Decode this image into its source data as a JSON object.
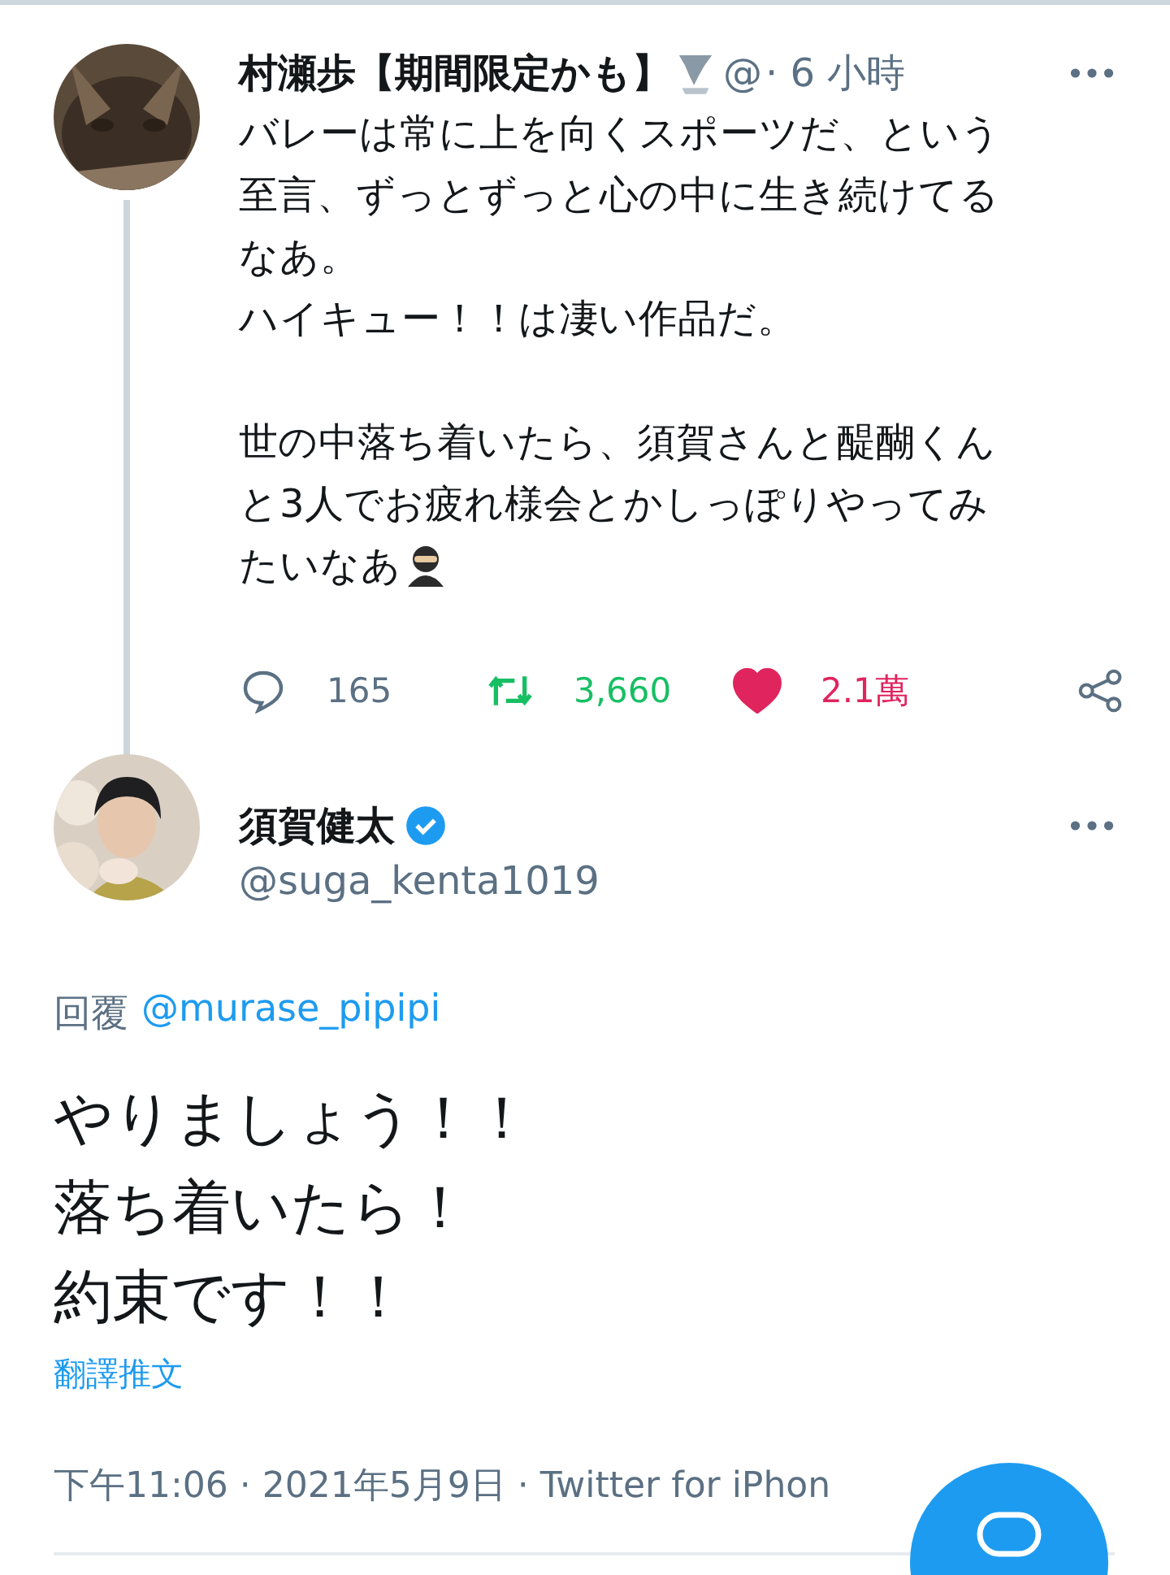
{
  "thread": [
    {
      "name": "村瀬歩【期間限定かも】",
      "handle": "@",
      "time": "· 6 小時",
      "paragraphs": [
        {
          "lines": [
            "バレーは常に上を向くスポーツだ、という",
            "至言、ずっとずっと心の中に生き続けてる",
            "なあ。",
            "ハイキュー！！は凄い作品だ。"
          ]
        },
        {
          "lines": [
            "世の中落ち着いたら、須賀さんと醍醐くん",
            "と3人でお疲れ様会とかしっぽりやってみ",
            "たいなあ"
          ]
        }
      ],
      "actions": {
        "replies": "165",
        "retweets": "3,660",
        "likes": "2.1萬",
        "liked": true
      }
    }
  ],
  "main": {
    "name": "須賀健太",
    "verified": true,
    "handle": "@suga_kenta1019",
    "reply_label": "回覆",
    "reply_to": "@murase_pipipi",
    "lines": [
      "やりましょう！！",
      "落ち着いたら！",
      "約束です！！"
    ],
    "translate": "翻譯推文",
    "meta": "下午11:06 · 2021年5月9日 · Twitter for iPhon"
  }
}
